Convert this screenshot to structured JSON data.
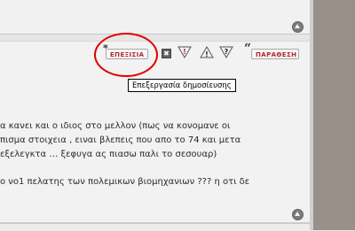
{
  "post_actions": {
    "edit_label": "ΕΠΕΞΙΣΙΑ",
    "edit_mark": "*",
    "delete_symbol": "✖",
    "report_symbol": "!",
    "warn_symbol": "!",
    "info_symbol": "?",
    "quote_mark": "“",
    "quote_label": "ΠΑΡΑΘΕΣΗ"
  },
  "tooltip": {
    "text": "Επεξεργασία δημοσίευσης"
  },
  "post_body": {
    "lines": [
      "α κανει και ο ιδιος στο μελλον (πως να κονομανε οι",
      "πισμα στοιχεια , ειναι βλεπεις που απο το 74 και μετα",
      "εξελεγκτα … ξεφυγα ας πιασω παλι το σεσουαρ)",
      " ο νο1 πελατης των πολεμικων βιομηχανιων ??? η οτι δε"
    ]
  },
  "colors": {
    "accent_red": "#b3262f",
    "highlight_ring": "#e00000"
  }
}
